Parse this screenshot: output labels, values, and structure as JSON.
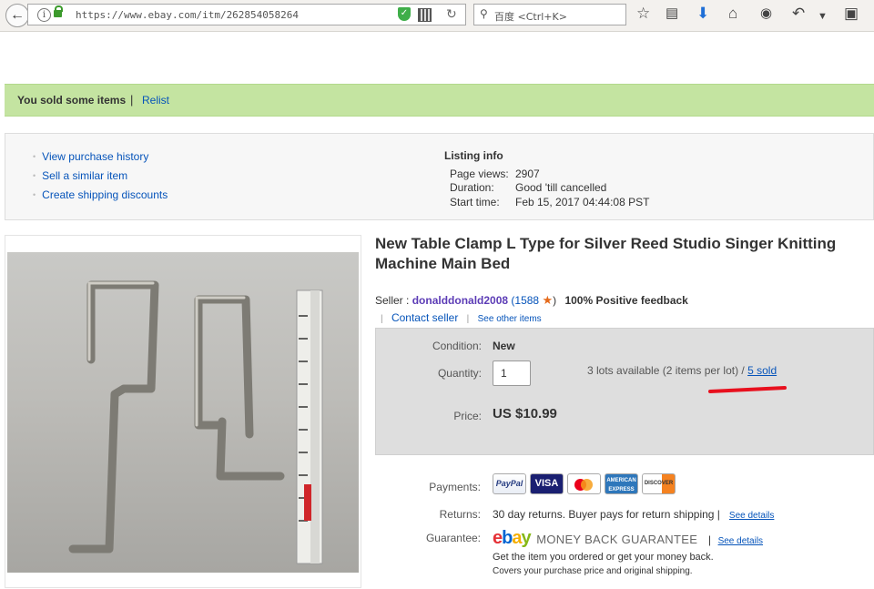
{
  "browser": {
    "url": "https://www.ebay.com/itm/262854058264",
    "search_placeholder": "百度 <Ctrl+K>"
  },
  "banner": {
    "message": "You sold some items",
    "separator": "|",
    "relist": "Relist"
  },
  "actions": {
    "items": [
      "View purchase history",
      "Sell a similar item",
      "Create shipping discounts"
    ]
  },
  "listing_info": {
    "title": "Listing info",
    "rows": [
      {
        "label": "Page views:",
        "value": "2907"
      },
      {
        "label": "Duration:",
        "value": "Good 'till cancelled"
      },
      {
        "label": "Start time:",
        "value": "Feb 15, 2017 04:44:08 PST"
      }
    ]
  },
  "item": {
    "title": "New Table Clamp L Type for Silver Reed Studio Singer Knitting Machine Main Bed",
    "seller_prefix": "Seller :",
    "seller_name": "donalddonald2008",
    "seller_score_open": "(1588",
    "seller_score_close": ")",
    "positive_feedback": "100% Positive feedback",
    "contact_seller": "Contact seller",
    "see_other_items": "See other items",
    "condition_label": "Condition:",
    "condition_value": "New",
    "quantity_label": "Quantity:",
    "quantity_value": "1",
    "availability": "3 lots available (2 items per lot) /",
    "sold": "5 sold",
    "price_label": "Price:",
    "price": "US $10.99",
    "payments_label": "Payments:",
    "payment_methods": [
      "PayPal",
      "VISA",
      "",
      "AMERICAN EXPRESS",
      "DISCOVER"
    ],
    "returns_label": "Returns:",
    "returns_text": "30 day returns. Buyer pays for return shipping |",
    "see_details": "See details",
    "guarantee_label": "Guarantee:",
    "mbg": "MONEY BACK GUARANTEE",
    "guarantee_sep": "|",
    "guarantee_line1": "Get the item you ordered or get your money back.",
    "guarantee_line2": "Covers your purchase price and original shipping."
  },
  "colors": {
    "link": "#0654ba",
    "banner": "#c4e4a1",
    "annotation": "#e8101e"
  }
}
